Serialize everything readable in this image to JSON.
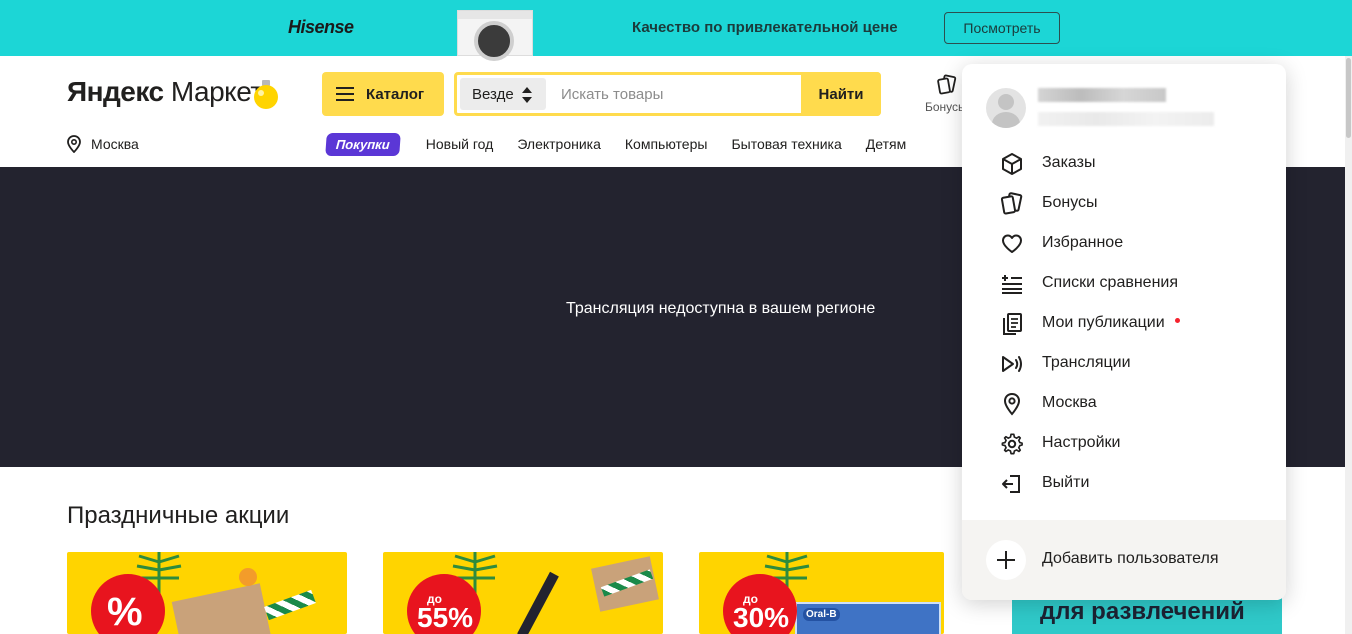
{
  "promo_banner": {
    "brand": "Hisense",
    "slogan": "Качество по привлекательной цене",
    "button": "Посмотреть",
    "color": "#1cd6d6"
  },
  "header": {
    "logo_bold": "Яндекс",
    "logo_light": " Маркет",
    "catalog_button": "Каталог",
    "search": {
      "scope": "Везде",
      "placeholder": "Искать товары",
      "value": "",
      "submit": "Найти"
    },
    "bonus_label": "Бонусы",
    "accent": "#ffdb4d"
  },
  "subnav": {
    "region": "Москва",
    "pill": "Покупки",
    "items": [
      "Новый год",
      "Электроника",
      "Компьютеры",
      "Бытовая техника",
      "Детям"
    ]
  },
  "stream": {
    "message": "Трансляция недоступна в вашем регионе"
  },
  "section": {
    "title": "Праздничные акции",
    "cards": [
      {
        "pre": "",
        "big": "%"
      },
      {
        "pre": "до",
        "big": "55%"
      },
      {
        "pre": "до",
        "big": "30%",
        "pack_label": "Oral-B"
      }
    ],
    "partial_card_text": "для развлечений"
  },
  "user_menu": {
    "items": [
      {
        "icon": "box-icon",
        "label": "Заказы"
      },
      {
        "icon": "bonus-cards-icon",
        "label": "Бонусы"
      },
      {
        "icon": "heart-icon",
        "label": "Избранное"
      },
      {
        "icon": "compare-list-icon",
        "label": "Списки сравнения"
      },
      {
        "icon": "publications-icon",
        "label": "Мои публикации",
        "has_dot": true
      },
      {
        "icon": "stream-play-icon",
        "label": "Трансляции"
      },
      {
        "icon": "location-pin-icon",
        "label": "Москва"
      },
      {
        "icon": "gear-icon",
        "label": "Настройки"
      },
      {
        "icon": "logout-icon",
        "label": "Выйти"
      }
    ],
    "add_user": "Добавить пользователя",
    "notification_dot_color": "#f5222d"
  }
}
